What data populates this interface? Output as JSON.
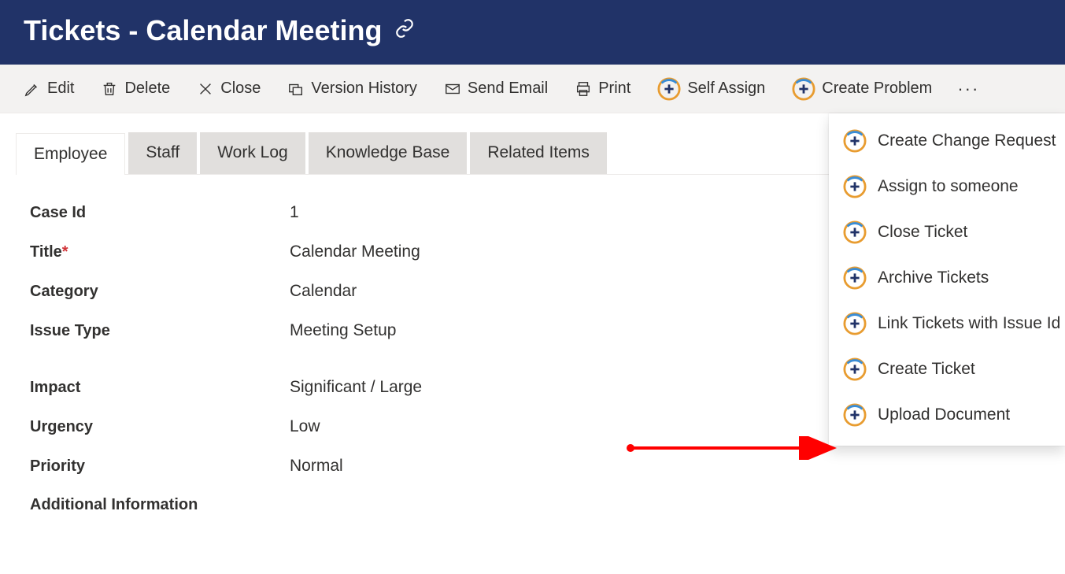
{
  "header": {
    "title": "Tickets - Calendar Meeting"
  },
  "toolbar": {
    "edit": "Edit",
    "delete": "Delete",
    "close": "Close",
    "version_history": "Version History",
    "send_email": "Send Email",
    "print": "Print",
    "self_assign": "Self Assign",
    "create_problem": "Create Problem"
  },
  "tabs": {
    "employee": "Employee",
    "staff": "Staff",
    "work_log": "Work Log",
    "knowledge_base": "Knowledge Base",
    "related_items": "Related Items"
  },
  "fields": {
    "case_id_label": "Case Id",
    "case_id_value": "1",
    "title_label": "Title",
    "title_value": "Calendar Meeting",
    "category_label": "Category",
    "category_value": "Calendar",
    "issue_type_label": "Issue Type",
    "issue_type_value": "Meeting Setup",
    "impact_label": "Impact",
    "impact_value": "Significant / Large",
    "urgency_label": "Urgency",
    "urgency_value": "Low",
    "priority_label": "Priority",
    "priority_value": "Normal",
    "additional_info_label": "Additional Information"
  },
  "dropdown": {
    "create_change_request": "Create Change Request",
    "assign_to_someone": "Assign to someone",
    "close_ticket": "Close Ticket",
    "archive_tickets": "Archive Tickets",
    "link_tickets": "Link Tickets with Issue Id",
    "create_ticket": "Create Ticket",
    "upload_document": "Upload Document"
  }
}
